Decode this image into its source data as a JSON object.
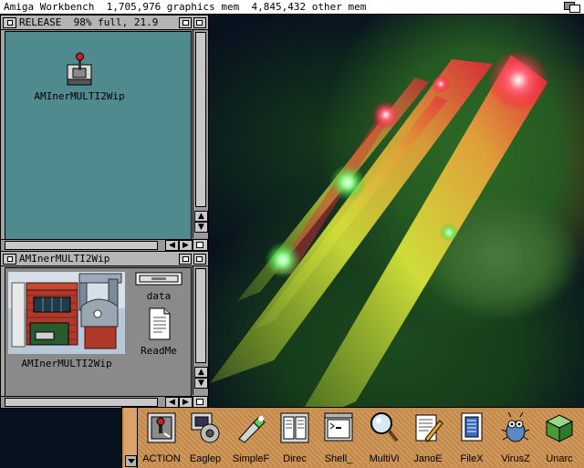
{
  "screen": {
    "title": "Amiga Workbench  1,705,976 graphics mem  4,845,432 other mem"
  },
  "release_window": {
    "title": "RELEASE  98% full, 21.9",
    "icon_label": "AMInerMULTI2Wip"
  },
  "drawer_window": {
    "title": "AMInerMULTI2Wip",
    "icons": {
      "game": "AMInerMULTI2Wip",
      "data": "data",
      "readme": "ReadMe"
    }
  },
  "dock": {
    "items": [
      {
        "label": "ACTION",
        "icon": "joystick-icon"
      },
      {
        "label": "Eaglep",
        "icon": "music-player-icon"
      },
      {
        "label": "SimpleF",
        "icon": "flashlight-icon"
      },
      {
        "label": "Direc",
        "icon": "directory-opus-icon"
      },
      {
        "label": "Shell_",
        "icon": "shell-icon"
      },
      {
        "label": "MultiVi",
        "icon": "magnifier-icon"
      },
      {
        "label": "JanoE",
        "icon": "editor-icon"
      },
      {
        "label": "FileX",
        "icon": "filex-icon"
      },
      {
        "label": "VirusZ",
        "icon": "bug-icon"
      },
      {
        "label": "Unarc",
        "icon": "cube-icon"
      }
    ]
  },
  "colors": {
    "wallpaper": "#08121f",
    "release_bg": "#4f8a8e",
    "drawer_bg": "#8a8a8a",
    "dock": "#c98f52",
    "titlebar": "#b5b5b5"
  }
}
